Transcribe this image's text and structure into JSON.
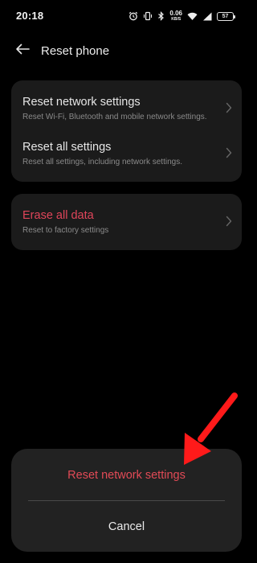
{
  "status_bar": {
    "time": "20:18",
    "net_speed_value": "0.06",
    "net_speed_unit": "KB/S",
    "battery_level": "57",
    "icons": [
      "alarm-icon",
      "vibrate-icon",
      "bluetooth-icon",
      "wifi-icon",
      "signal-icon",
      "battery-icon"
    ]
  },
  "header": {
    "back_icon": "back-arrow-icon",
    "title": "Reset phone"
  },
  "settings": {
    "group1": [
      {
        "title": "Reset network settings",
        "subtitle": "Reset Wi-Fi, Bluetooth and mobile network settings."
      },
      {
        "title": "Reset all settings",
        "subtitle": "Reset all settings, including network settings."
      }
    ],
    "group2": [
      {
        "title": "Erase all data",
        "subtitle": "Reset to factory settings"
      }
    ]
  },
  "bottom_sheet": {
    "action_label": "Reset network settings",
    "cancel_label": "Cancel"
  },
  "colors": {
    "background": "#000000",
    "card": "#1b1b1b",
    "sheet": "#222222",
    "danger": "#e0455a",
    "annotation_arrow": "#ff1a1a"
  }
}
